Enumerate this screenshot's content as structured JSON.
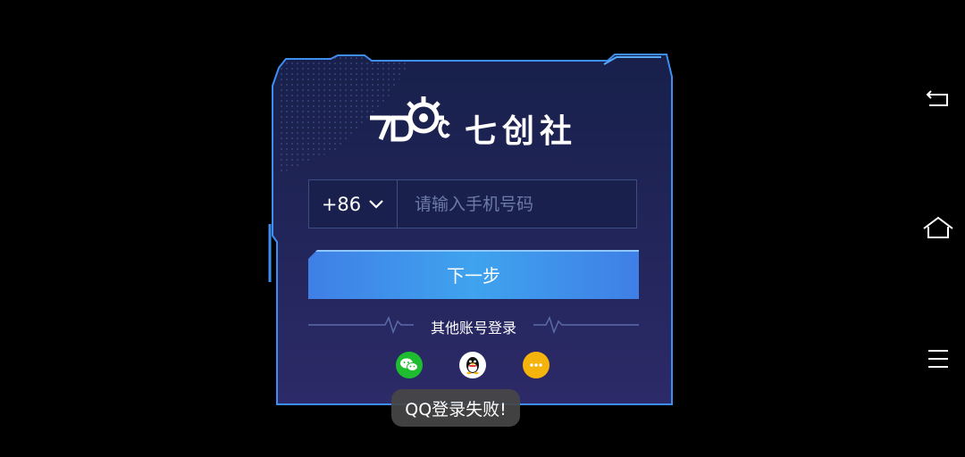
{
  "brand": {
    "logo_mark": "7DC",
    "name": "七创社"
  },
  "login": {
    "country_code": "+86",
    "phone_placeholder": "请输入手机号码",
    "next_label": "下一步",
    "other_login_label": "其他账号登录",
    "social": [
      {
        "name": "wechat",
        "icon": "wechat-icon"
      },
      {
        "name": "qq",
        "icon": "qq-penguin-icon"
      },
      {
        "name": "more",
        "icon": "more-dots-icon"
      }
    ]
  },
  "toast": {
    "message": "QQ登录失败!"
  },
  "nav_bar": {
    "icons": [
      "back-icon",
      "home-icon",
      "menu-icon"
    ]
  },
  "colors": {
    "panel_top": "#17204a",
    "panel_bottom": "#2a2a66",
    "panel_border": "#3d8ef0",
    "button_gradient": [
      "#3f7fe6",
      "#3fa3ee"
    ],
    "wechat": "#1ebd2f",
    "more": "#f5b40c"
  }
}
